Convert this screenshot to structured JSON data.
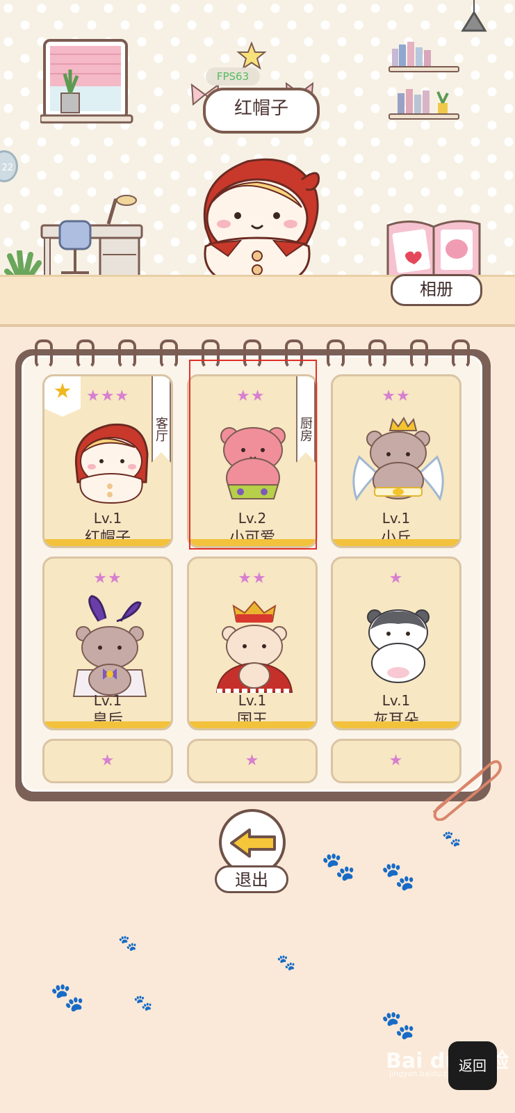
{
  "header": {
    "character_name": "红帽子",
    "fps_text": "FPS63",
    "album_label": "相册",
    "side_badge": "22"
  },
  "collection": {
    "cards": [
      {
        "level": "Lv.1",
        "name": "红帽子",
        "stars": 3,
        "stars_text": "★★★",
        "room": "客厅",
        "favorite": true,
        "favorite_icon": "★"
      },
      {
        "level": "Lv.2",
        "name": "小可爱",
        "stars": 2,
        "stars_text": "★★",
        "room": "厨房",
        "favorite": false,
        "selected": true
      },
      {
        "level": "Lv.1",
        "name": "小丘",
        "stars": 2,
        "stars_text": "★★"
      },
      {
        "level": "Lv.1",
        "name": "皇后",
        "stars": 2,
        "stars_text": "★★"
      },
      {
        "level": "Lv.1",
        "name": "国王",
        "stars": 2,
        "stars_text": "★★"
      },
      {
        "level": "Lv.1",
        "name": "灰耳朵",
        "stars": 1,
        "stars_text": "★"
      },
      {
        "stars": 1,
        "stars_text": "★"
      },
      {
        "stars": 1,
        "stars_text": "★"
      },
      {
        "stars": 1,
        "stars_text": "★"
      }
    ]
  },
  "footer": {
    "exit_label": "退出",
    "back_label": "返回"
  },
  "watermark": {
    "text": "Bai du 经验",
    "sub": "jingyan.baidu.com"
  },
  "colors": {
    "star_purple": "#d77fd0",
    "card_bg": "#f7e7c2",
    "card_bottom": "#f2c23c",
    "highlight": "#e0302a",
    "frame_brown": "#7b6058"
  }
}
